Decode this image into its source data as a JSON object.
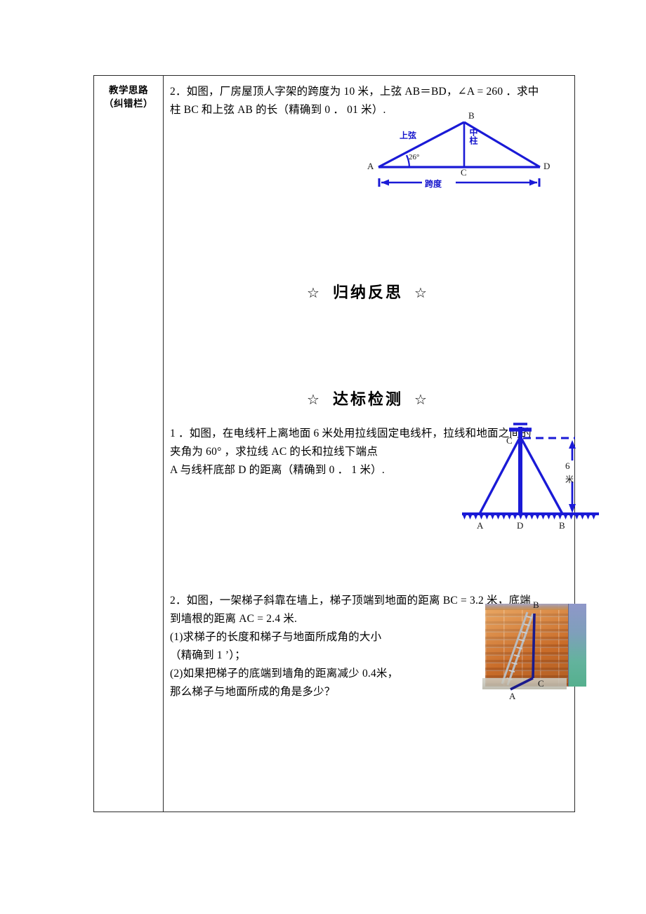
{
  "document": {
    "left_column": {
      "line1": "教学思路",
      "line2": "（纠错栏）"
    }
  },
  "problem_top": {
    "line1": "2．如图，厂房屋顶人字架的跨度为 10 米，上弦 AB＝BD，∠A = 260 ．求中",
    "line2": "柱 BC 和上弦 AB 的长（精确到 0 ． 01 米）."
  },
  "truss_figure": {
    "name": "roof-truss-diagram",
    "labels": {
      "A": "A",
      "B": "B",
      "C": "C",
      "D": "D",
      "angle": "26°",
      "upper_chord": "上弦",
      "center_post": "中柱",
      "span": "跨度"
    },
    "line_color": "#1a1ad6"
  },
  "sections": {
    "reflection": {
      "star_left": "☆",
      "title": "归纳反思",
      "star_right": "☆"
    },
    "test": {
      "star_left": "☆",
      "title": "达标检测",
      "star_right": "☆"
    }
  },
  "test_problem_1": {
    "line1": "1 ．如图，在电线杆上离地面 6 米处用拉线固定电线杆，拉线和地面之间的",
    "line2": "夹角为 60°  ，求拉线 AC 的长和拉线下端点",
    "line3": "A 与线杆底部 D 的距离（精确到 0 ． 1 米）."
  },
  "pole_figure": {
    "name": "utility-pole-diagram",
    "labels": {
      "A": "A",
      "B": "B",
      "C": "C",
      "D": "D",
      "height_value": "6",
      "height_unit": "米"
    },
    "line_color": "#1a1ad6"
  },
  "test_problem_2": {
    "line1": "2．如图，一架梯子斜靠在墙上，梯子顶端到地面的距离 BC = 3.2 米，底端",
    "line2": "到墙根的距离 AC = 2.4 米.",
    "line3": "(1)求梯子的长度和梯子与地面所成角的大小",
    "line4": "（精确到 1 ’）；",
    "line5": "(2)如果把梯子的底端到墙角的距离减少 0.4米，",
    "line6": "那么梯子与地面所成的角是多少？"
  },
  "ladder_figure": {
    "name": "ladder-wall-photo",
    "labels": {
      "A": "A",
      "B": "B",
      "C": "C"
    },
    "line_color": "#1a1a8c"
  }
}
